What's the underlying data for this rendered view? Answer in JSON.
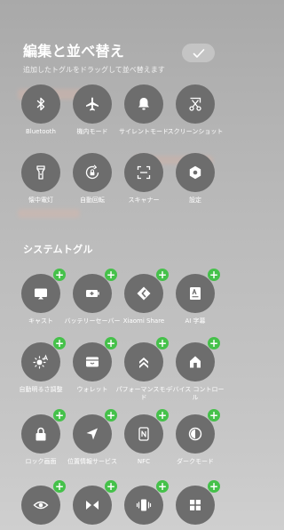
{
  "header": {
    "title": "編集と並べ替え",
    "subtitle": "追加したトグルをドラッグして並べ替えます",
    "done_icon": "checkmark-icon"
  },
  "active_toggles": [
    {
      "label": "Bluetooth",
      "icon": "bluetooth-icon"
    },
    {
      "label": "機内モード",
      "icon": "airplane-icon"
    },
    {
      "label": "サイレントモード",
      "icon": "bell-icon"
    },
    {
      "label": "スクリーンショット",
      "icon": "scissors-icon"
    },
    {
      "label": "懐中電灯",
      "icon": "flashlight-icon"
    },
    {
      "label": "自動回転",
      "icon": "rotation-lock-icon"
    },
    {
      "label": "スキャナー",
      "icon": "scanner-icon"
    },
    {
      "label": "設定",
      "icon": "gear-icon"
    }
  ],
  "system_section": {
    "title": "システムトグル",
    "items": [
      {
        "label": "キャスト",
        "icon": "cast-icon"
      },
      {
        "label": "バッテリーセーバー",
        "icon": "battery-saver-icon"
      },
      {
        "label": "Xiaomi Share",
        "icon": "xiaomi-share-icon"
      },
      {
        "label": "AI 字幕",
        "icon": "ai-caption-icon"
      },
      {
        "label": "自動明るさ調整",
        "icon": "auto-brightness-icon"
      },
      {
        "label": "ウォレット",
        "icon": "wallet-icon"
      },
      {
        "label": "パフォーマンスモード",
        "icon": "performance-icon"
      },
      {
        "label": "デバイス コントロール",
        "icon": "home-icon"
      },
      {
        "label": "ロック画面",
        "icon": "lock-icon"
      },
      {
        "label": "位置情報サービス",
        "icon": "location-icon"
      },
      {
        "label": "NFC",
        "icon": "nfc-icon"
      },
      {
        "label": "ダークモード",
        "icon": "dark-mode-icon"
      },
      {
        "label": "",
        "icon": "eye-icon"
      },
      {
        "label": "",
        "icon": "bowtie-icon"
      },
      {
        "label": "",
        "icon": "vibrate-icon"
      },
      {
        "label": "",
        "icon": "grid-icon"
      }
    ],
    "add_symbol": "+"
  },
  "colors": {
    "tile_bg": "#6d6d6d",
    "add_badge": "#45c14a"
  }
}
